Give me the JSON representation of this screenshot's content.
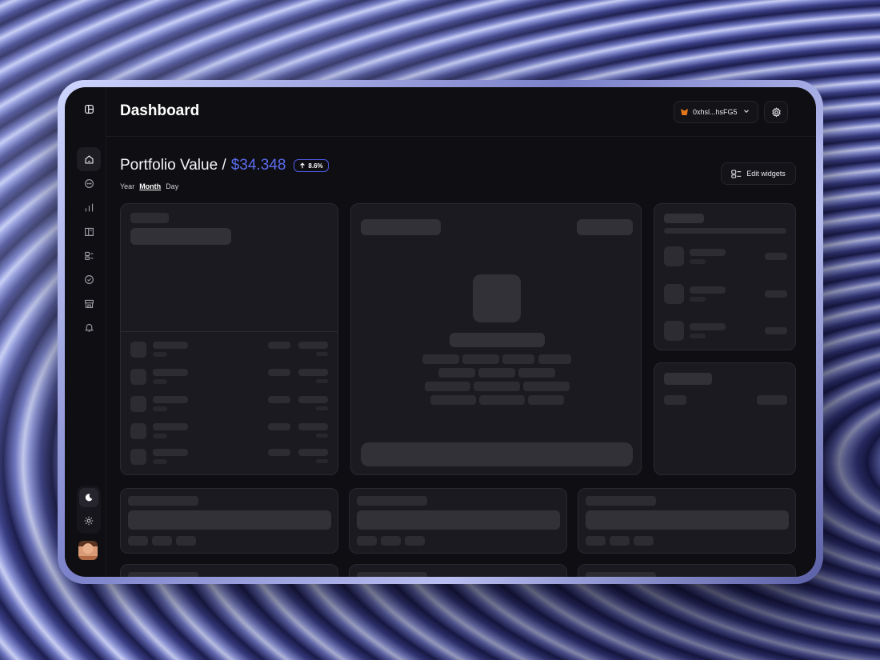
{
  "header": {
    "title": "Dashboard"
  },
  "wallet": {
    "address": "0xhsl...hsFG5",
    "icon": "metamask-fox-icon",
    "brand_color": "#e2761b"
  },
  "portfolio": {
    "label": "Portfolio Value /",
    "value": "$34.348",
    "change": "8.6%",
    "value_color": "#5b6cf0"
  },
  "ranges": [
    "Year",
    "Month",
    "Day"
  ],
  "selected_range": "Month",
  "edit_widgets_label": "Edit widgets",
  "sidebar": {
    "items": [
      "home-icon",
      "chat-icon",
      "bar-chart-icon",
      "book-icon",
      "widgets-icon",
      "check-circle-icon",
      "store-icon",
      "bell-icon"
    ],
    "active": "home-icon"
  },
  "theme": {
    "active": "dark"
  }
}
